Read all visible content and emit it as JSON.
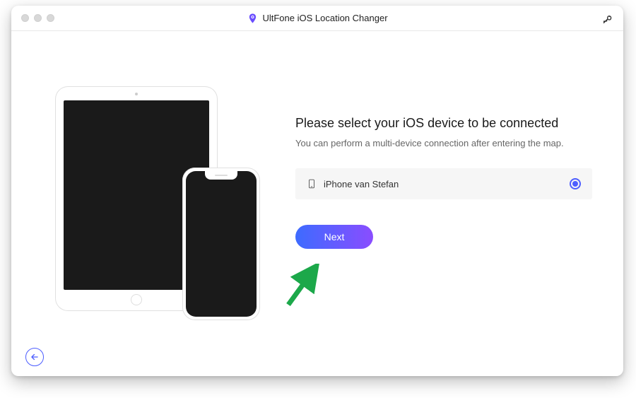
{
  "title": "UltFone iOS Location Changer",
  "heading": "Please select your iOS device to be connected",
  "subtitle": "You can perform a multi-device connection after entering the map.",
  "devices": [
    {
      "name": "iPhone van Stefan",
      "selected": true
    }
  ],
  "next_label": "Next"
}
